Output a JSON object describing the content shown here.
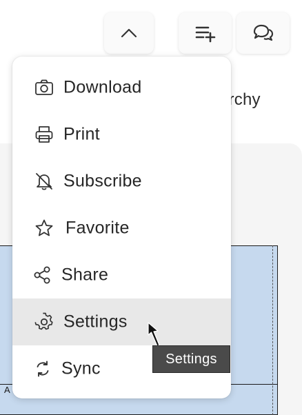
{
  "background": {
    "heading_fragment": "archy",
    "chart_label_fragment": "A"
  },
  "toolbar": {
    "collapse_icon": "chevron-up-icon",
    "add_to_list_icon": "playlist-add-icon",
    "comments_icon": "comments-icon"
  },
  "menu": {
    "items": [
      {
        "label": "Download",
        "icon": "camera-icon"
      },
      {
        "label": "Print",
        "icon": "printer-icon"
      },
      {
        "label": "Subscribe",
        "icon": "bell-off-icon"
      },
      {
        "label": "Favorite",
        "icon": "star-icon"
      },
      {
        "label": "Share",
        "icon": "share-icon"
      },
      {
        "label": "Settings",
        "icon": "gear-icon",
        "highlighted": true
      },
      {
        "label": "Sync",
        "icon": "sync-icon"
      }
    ]
  },
  "tooltip": {
    "text": "Settings"
  },
  "colors": {
    "menu_highlight": "#e8e8e8",
    "tooltip_bg": "#4a4a4a",
    "chart_fill": "#c6d9ee"
  }
}
